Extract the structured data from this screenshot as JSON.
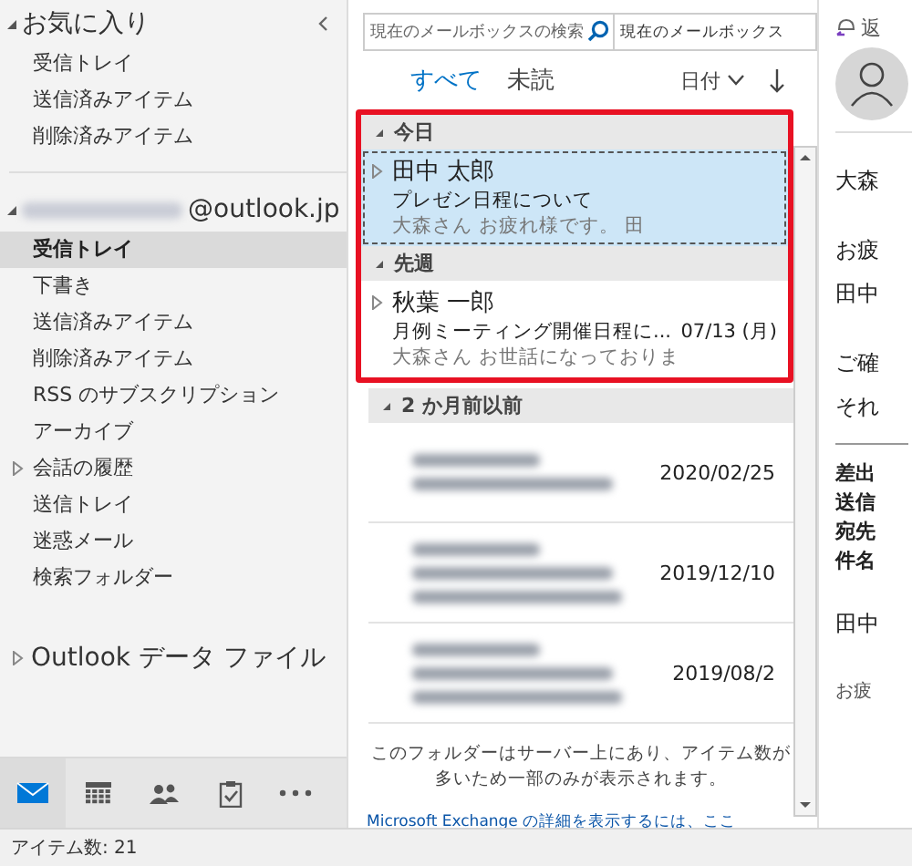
{
  "sidebar": {
    "favorites": {
      "title": "お気に入り",
      "expanded": true,
      "items": [
        {
          "label": "受信トレイ"
        },
        {
          "label": "送信済みアイテム"
        },
        {
          "label": "削除済みアイテム"
        }
      ]
    },
    "account": {
      "address": "@outlook.jp",
      "name_blurred": true,
      "expanded": true,
      "items": [
        {
          "label": "受信トレイ",
          "selected": true,
          "has_children": false
        },
        {
          "label": "下書き",
          "selected": false,
          "has_children": false
        },
        {
          "label": "送信済みアイテム",
          "selected": false,
          "has_children": false
        },
        {
          "label": "削除済みアイテム",
          "selected": false,
          "has_children": false
        },
        {
          "label": "RSS のサブスクリプション",
          "selected": false,
          "has_children": false
        },
        {
          "label": "アーカイブ",
          "selected": false,
          "has_children": false
        },
        {
          "label": "会話の履歴",
          "selected": false,
          "has_children": true
        },
        {
          "label": "送信トレイ",
          "selected": false,
          "has_children": false
        },
        {
          "label": "迷惑メール",
          "selected": false,
          "has_children": false
        },
        {
          "label": "検索フォルダー",
          "selected": false,
          "has_children": false
        }
      ]
    },
    "data_file": {
      "label": "Outlook データ ファイル",
      "expanded": false
    },
    "nav": [
      {
        "kind": "mail",
        "selected": true
      },
      {
        "kind": "calendar",
        "selected": false
      },
      {
        "kind": "people",
        "selected": false
      },
      {
        "kind": "tasks",
        "selected": false
      },
      {
        "kind": "more",
        "selected": false
      }
    ]
  },
  "mail_list": {
    "search": {
      "placeholder": "現在のメールボックスの検索"
    },
    "scope": "現在のメールボックス",
    "filters": [
      {
        "label": "すべて",
        "selected": true
      },
      {
        "label": "未読",
        "selected": false
      }
    ],
    "sort": "日付",
    "framed_groups": [
      {
        "title": "今日",
        "items": [
          {
            "kind": "mail",
            "sender": "田中 太郎",
            "subject": "プレゼン日程について",
            "preview": "大森さん  お疲れ様です。 田",
            "selected": true
          }
        ]
      },
      {
        "title": "先週",
        "items": [
          {
            "kind": "mail",
            "sender": "秋葉 一郎",
            "subject": "月例ミーティング開催日程に...",
            "preview": "大森さん  お世話になっておりま",
            "date": "07/13 (月)",
            "selected": false
          }
        ]
      }
    ],
    "groups": [
      {
        "title": "2 か月前以前",
        "items": [
          {
            "kind": "blurred",
            "preview_shown": false,
            "date": "2020/02/25",
            "selected": false
          },
          {
            "kind": "blurred",
            "preview_shown": true,
            "date": "2019/12/10",
            "selected": false
          },
          {
            "kind": "blurred",
            "preview_shown": true,
            "date": "2019/08/2",
            "selected": false
          }
        ]
      }
    ],
    "notice": "このフォルダーはサーバー上にあり、アイテム数が多いため一部のみが表示されます。",
    "link": "Microsoft Exchange の詳細を表示するには、ここ"
  },
  "reading_pane": {
    "reply": "返",
    "paragraphs": [
      {
        "kind": "body",
        "lines": [
          "大森"
        ]
      },
      {
        "kind": "body",
        "lines": [
          "お疲",
          "田中"
        ]
      },
      {
        "kind": "body",
        "lines": [
          "ご確",
          "それ"
        ]
      },
      {
        "kind": "header",
        "lines": [
          "差出",
          "送信",
          "宛先",
          "件名"
        ]
      },
      {
        "kind": "body",
        "lines": [
          "田中"
        ]
      },
      {
        "kind": "small",
        "lines": [
          "お疲"
        ]
      }
    ]
  },
  "status_bar": {
    "item_count": "アイテム数: 21"
  }
}
